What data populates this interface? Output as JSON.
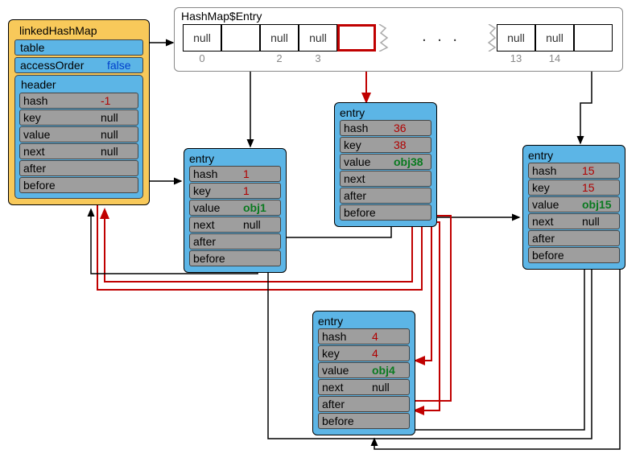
{
  "hashmap": {
    "title": "HashMap$Entry",
    "cells": [
      {
        "label": "null",
        "idx": "0"
      },
      {
        "label": "",
        "idx": ""
      },
      {
        "label": "null",
        "idx": "2"
      },
      {
        "label": "null",
        "idx": "3"
      },
      {
        "label": "",
        "idx": "",
        "highlight": true
      },
      {
        "label": "null",
        "idx": "13"
      },
      {
        "label": "null",
        "idx": "14"
      },
      {
        "label": "",
        "idx": ""
      }
    ],
    "ellipsis": ". . ."
  },
  "lhm": {
    "title": "linkedHashMap",
    "rows": {
      "table": "table",
      "accessOrder_k": "accessOrder",
      "accessOrder_v": "false"
    },
    "header": {
      "title": "header",
      "hash_k": "hash",
      "hash_v": "-1",
      "key_k": "key",
      "key_v": "null",
      "value_k": "value",
      "value_v": "null",
      "next_k": "next",
      "next_v": "null",
      "after_k": "after",
      "before_k": "before"
    }
  },
  "entry1": {
    "title": "entry",
    "hash_k": "hash",
    "hash_v": "1",
    "key_k": "key",
    "key_v": "1",
    "value_k": "value",
    "value_v": "obj1",
    "next_k": "next",
    "next_v": "null",
    "after_k": "after",
    "before_k": "before"
  },
  "entry36": {
    "title": "entry",
    "hash_k": "hash",
    "hash_v": "36",
    "key_k": "key",
    "key_v": "38",
    "value_k": "value",
    "value_v": "obj38",
    "next_k": "next",
    "after_k": "after",
    "before_k": "before"
  },
  "entry15": {
    "title": "entry",
    "hash_k": "hash",
    "hash_v": "15",
    "key_k": "key",
    "key_v": "15",
    "value_k": "value",
    "value_v": "obj15",
    "next_k": "next",
    "next_v": "null",
    "after_k": "after",
    "before_k": "before"
  },
  "entry4": {
    "title": "entry",
    "hash_k": "hash",
    "hash_v": "4",
    "key_k": "key",
    "key_v": "4",
    "value_k": "value",
    "value_v": "obj4",
    "next_k": "next",
    "next_v": "null",
    "after_k": "after",
    "before_k": "before"
  }
}
